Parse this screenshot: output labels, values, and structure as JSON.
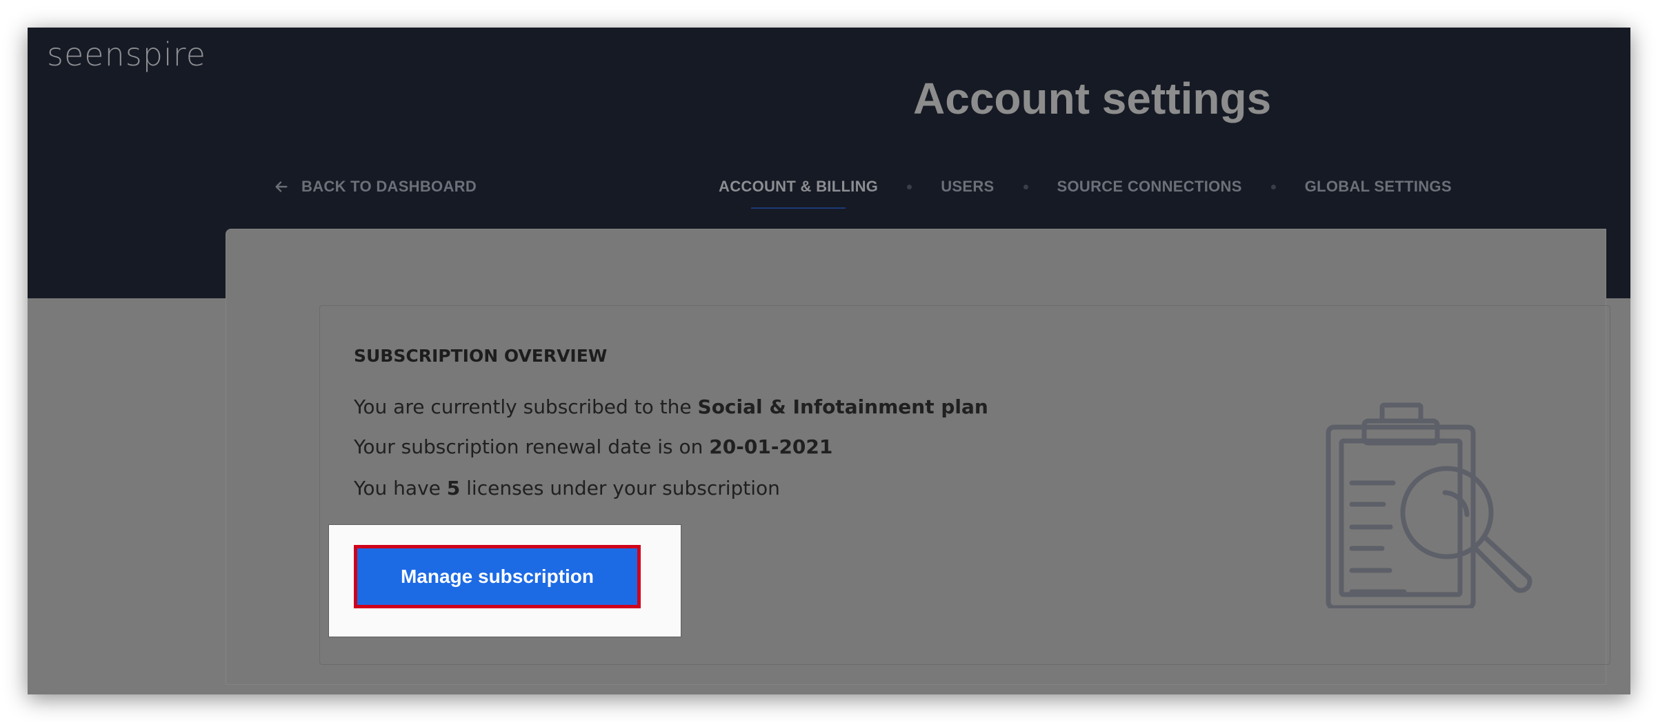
{
  "app": {
    "logo_text": "seenspire"
  },
  "header": {
    "title": "Account settings",
    "back_label": "BACK TO DASHBOARD",
    "tabs": [
      {
        "label": "ACCOUNT & BILLING",
        "active": true
      },
      {
        "label": "USERS",
        "active": false
      },
      {
        "label": "SOURCE CONNECTIONS",
        "active": false
      },
      {
        "label": "GLOBAL SETTINGS",
        "active": false
      }
    ]
  },
  "subscription": {
    "heading": "SUBSCRIPTION OVERVIEW",
    "line1_prefix": "You are currently subscribed to the ",
    "plan": "Social & Infotainment plan",
    "line2_prefix": "Your subscription renewal date is on ",
    "renewal_date": "20-01-2021",
    "line3_prefix": "You have ",
    "licenses": "5",
    "line3_suffix": " licenses under your subscription",
    "button_label": "Manage subscription",
    "illustration_icon": "clipboard-search-icon"
  },
  "colors": {
    "header_bg": "#161a24",
    "overlay": "#7a7a7a",
    "button_bg": "#1d6ae5",
    "button_highlight": "#d0021b"
  }
}
